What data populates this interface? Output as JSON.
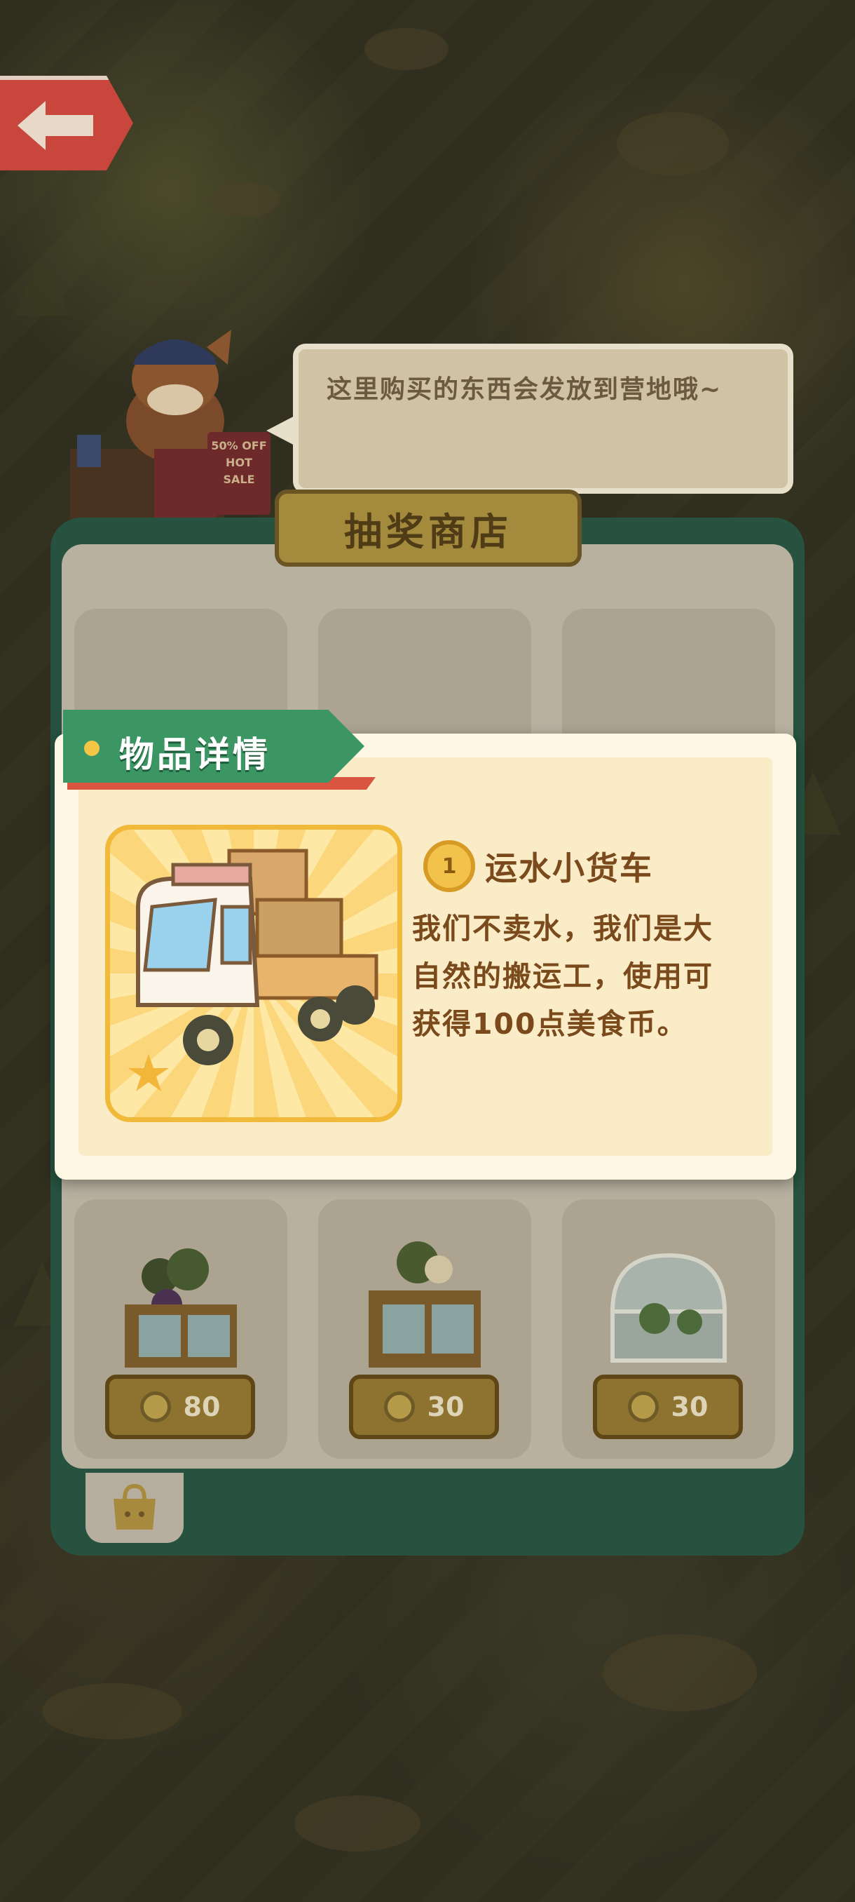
{
  "bubble": {
    "text": "这里购买的东西会发放到营地哦~"
  },
  "shop": {
    "title": "抽奖商店",
    "hot_sale_sign": "50% OFF HOT SALE",
    "items": [
      {
        "price": "80",
        "icon": "grape-planter-icon"
      },
      {
        "price": "30",
        "icon": "flower-planter-icon"
      },
      {
        "price": "30",
        "icon": "greenhouse-icon"
      }
    ]
  },
  "detail": {
    "header": "物品详情",
    "medal": "1",
    "name": "运水小货车",
    "description": "我们不卖水，我们是大自然的搬运工，使用可获得100点美食币。"
  },
  "colors": {
    "panel_green": "#26523f",
    "ribbon_green": "#3b9664",
    "ribbon_red": "#d9553f",
    "text_brown": "#7a4a1c",
    "card_gold": "#f1b93a"
  }
}
